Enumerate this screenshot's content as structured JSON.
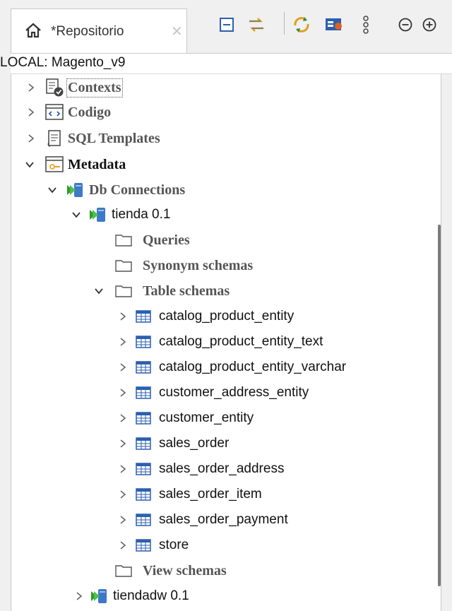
{
  "tab": {
    "title": "*Repositorio",
    "close": "✕"
  },
  "toolbar": {
    "buttons": [
      "collapse-all",
      "link-with-editor",
      "refresh",
      "filter-view",
      "view-menu",
      "minimize",
      "maximize"
    ]
  },
  "location": "LOCAL: Magento_v9",
  "tree": {
    "contexts": "Contexts",
    "codigo": "Codigo",
    "sql_templates": "SQL Templates",
    "metadata": "Metadata",
    "db_connections": "Db Connections",
    "tienda": "tienda 0.1",
    "queries": "Queries",
    "synonym_schemas": "Synonym schemas",
    "table_schemas": "Table schemas",
    "tables": [
      "catalog_product_entity",
      "catalog_product_entity_text",
      "catalog_product_entity_varchar",
      "customer_address_entity",
      "customer_entity",
      "sales_order",
      "sales_order_address",
      "sales_order_item",
      "sales_order_payment",
      "store"
    ],
    "view_schemas": "View schemas",
    "tiendadw": "tiendadw 0.1"
  },
  "colors": {
    "accent_green": "#2e9b2e",
    "db_blue": "#3d79c7",
    "folder_orange": "#f0a030"
  }
}
